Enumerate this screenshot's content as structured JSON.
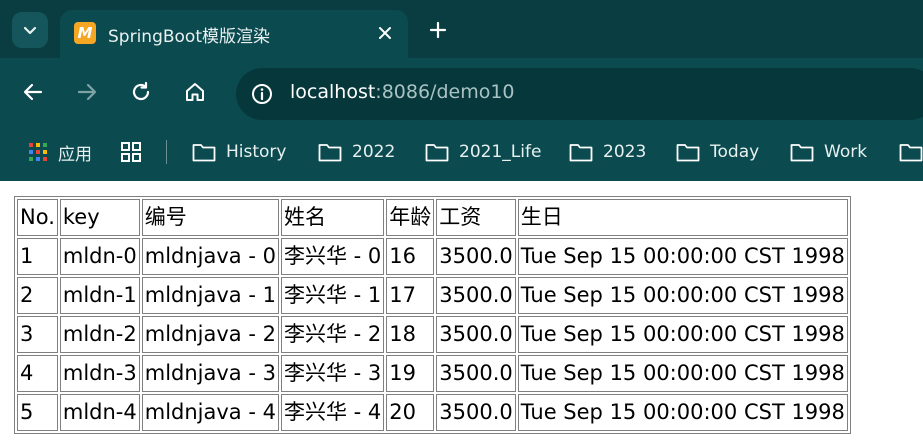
{
  "browser": {
    "tab_title": "SpringBoot模版渲染",
    "favicon_letter": "M",
    "url_host": "localhost",
    "url_path": ":8086/demo10",
    "bookmarks": [
      {
        "label": "应用",
        "icon": "apps-grid-icon"
      },
      {
        "label": "",
        "icon": "tab-groups-icon"
      },
      {
        "label": "History",
        "icon": "folder-icon"
      },
      {
        "label": "2022",
        "icon": "folder-icon"
      },
      {
        "label": "2021_Life",
        "icon": "folder-icon"
      },
      {
        "label": "2023",
        "icon": "folder-icon"
      },
      {
        "label": "Today",
        "icon": "folder-icon"
      },
      {
        "label": "Work",
        "icon": "folder-icon"
      }
    ]
  },
  "table": {
    "headers": [
      "No.",
      "key",
      "编号",
      "姓名",
      "年龄",
      "工资",
      "生日"
    ],
    "rows": [
      [
        "1",
        "mldn-0",
        "mldnjava - 0",
        "李兴华 - 0",
        "16",
        "3500.0",
        "Tue Sep 15 00:00:00 CST 1998"
      ],
      [
        "2",
        "mldn-1",
        "mldnjava - 1",
        "李兴华 - 1",
        "17",
        "3500.0",
        "Tue Sep 15 00:00:00 CST 1998"
      ],
      [
        "3",
        "mldn-2",
        "mldnjava - 2",
        "李兴华 - 2",
        "18",
        "3500.0",
        "Tue Sep 15 00:00:00 CST 1998"
      ],
      [
        "4",
        "mldn-3",
        "mldnjava - 3",
        "李兴华 - 3",
        "19",
        "3500.0",
        "Tue Sep 15 00:00:00 CST 1998"
      ],
      [
        "5",
        "mldn-4",
        "mldnjava - 4",
        "李兴华 - 4",
        "20",
        "3500.0",
        "Tue Sep 15 00:00:00 CST 1998"
      ]
    ]
  },
  "colors": {
    "chrome_bg": "#0b4a4f",
    "tabstrip_bg": "#0a3d41",
    "omnibox_bg": "#06373b",
    "favicon_bg": "#f5a623"
  }
}
